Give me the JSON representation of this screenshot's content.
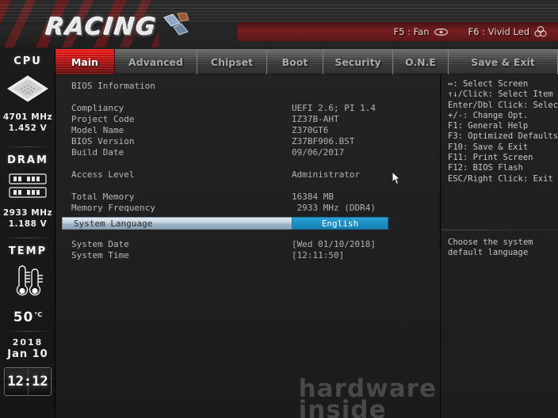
{
  "header": {
    "logo_text": "RACING",
    "fkeys": [
      {
        "label": "F5 : Fan",
        "icon": "fan-icon"
      },
      {
        "label": "F6 : Vivid Led",
        "icon": "rgb-led-icon"
      }
    ]
  },
  "tabs": [
    {
      "label": "Main",
      "active": true
    },
    {
      "label": "Advanced",
      "active": false
    },
    {
      "label": "Chipset",
      "active": false
    },
    {
      "label": "Boot",
      "active": false
    },
    {
      "label": "Security",
      "active": false
    },
    {
      "label": "O.N.E",
      "active": false
    },
    {
      "label": "Save & Exit",
      "active": false
    }
  ],
  "sidebar": {
    "cpu": {
      "title": "CPU",
      "icon": "cpu-chip-icon",
      "freq": "4701 MHz",
      "volt": "1.452 V"
    },
    "dram": {
      "title": "DRAM",
      "icon": "ram-module-icon",
      "freq": "2933 MHz",
      "volt": "1.188 V"
    },
    "temp": {
      "title": "TEMP",
      "icon": "thermometer-icon",
      "value": "50",
      "unit": "°C"
    },
    "clock": {
      "year": "2018",
      "date": "Jan 10",
      "time": "12:12"
    }
  },
  "main": {
    "section_title": "BIOS Information",
    "info_rows": [
      {
        "label": "Compliancy",
        "value": "UEFI 2.6; PI 1.4"
      },
      {
        "label": "Project Code",
        "value": "IZ37B-AHT"
      },
      {
        "label": "Model Name",
        "value": "Z370GT6"
      },
      {
        "label": "BIOS Version",
        "value": "Z37BF906.BST"
      },
      {
        "label": "Build Date",
        "value": "09/06/2017"
      }
    ],
    "access_row": {
      "label": "Access Level",
      "value": "Administrator"
    },
    "memory_rows": [
      {
        "label": "Total Memory",
        "value": "16384 MB"
      },
      {
        "label": "Memory Frequency",
        "value": " 2933 MHz (DDR4)"
      }
    ],
    "selected_row": {
      "label": "System Language",
      "value": "English"
    },
    "datetime_rows": [
      {
        "label": "System Date",
        "value": "[Wed 01/10/2018]"
      },
      {
        "label": "System Time",
        "value": "[12:11:50]"
      }
    ]
  },
  "help": {
    "shortcuts": [
      "↔: Select Screen",
      "↑↓/Click: Select Item",
      "Enter/Dbl Click: Select",
      "+/-: Change Opt.",
      "F1: General Help",
      "F3: Optimized Defaults",
      "F10: Save & Exit",
      "F11: Print Screen",
      "F12: BIOS Flash",
      "ESC/Right Click: Exit"
    ],
    "description": "Choose the system\ndefault language"
  },
  "watermark": {
    "line1": "hardware",
    "line2": "inside"
  }
}
